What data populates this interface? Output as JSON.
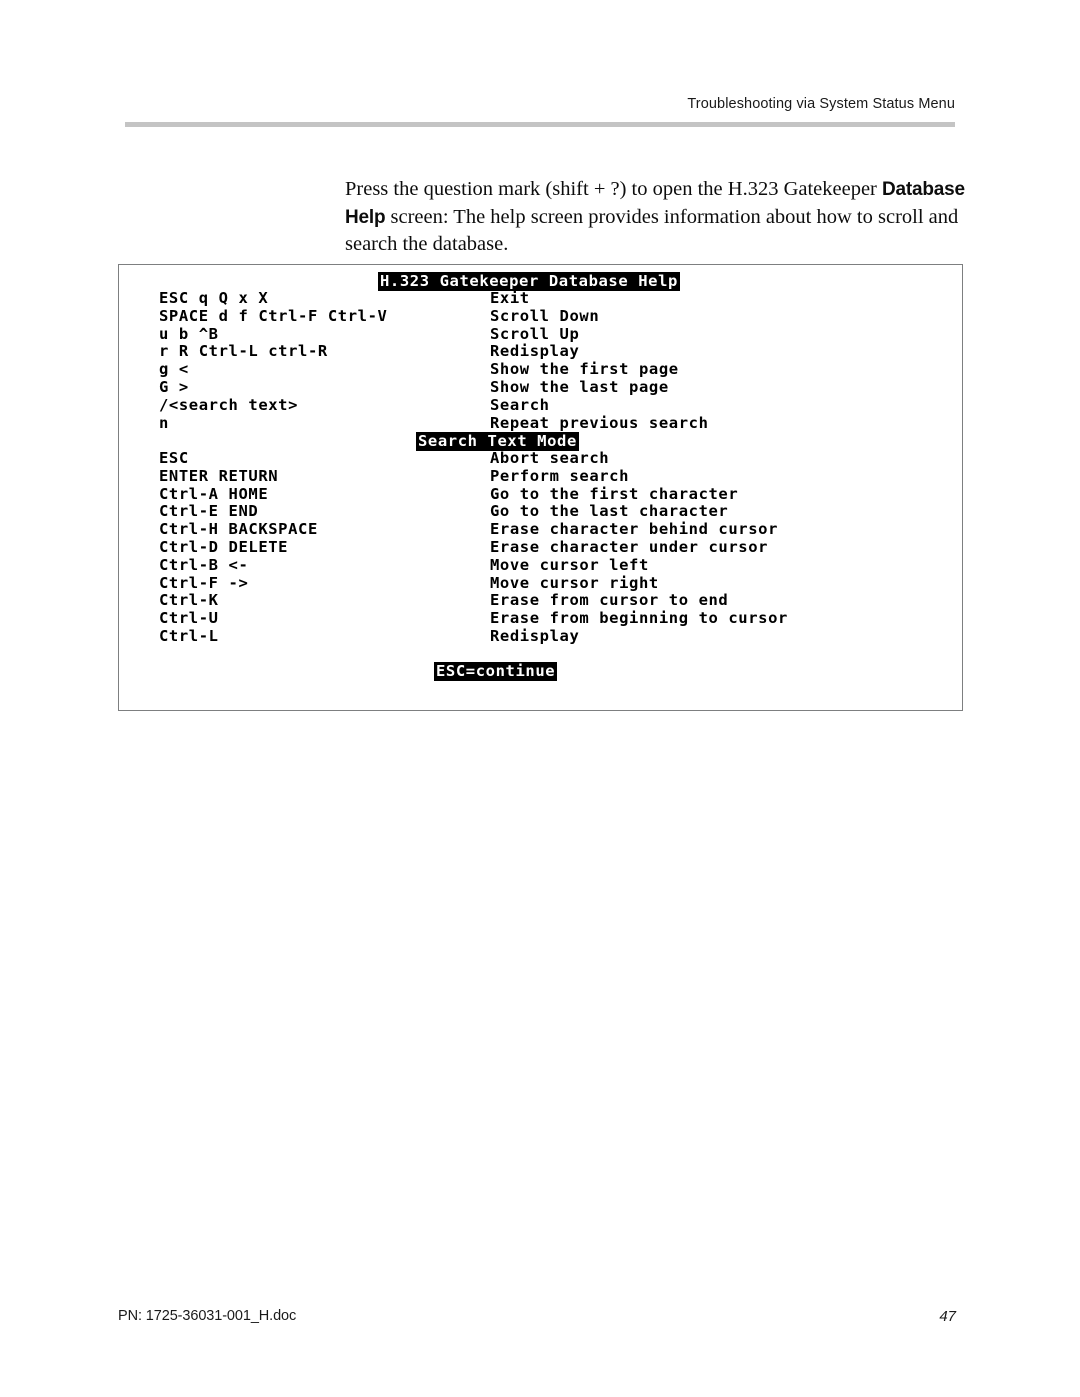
{
  "header": {
    "running_title": "Troubleshooting via System Status Menu",
    "rule_color": "#c4c4c4"
  },
  "body": {
    "paragraph_part1": "Press the question mark (shift + ?) to open the H.323 Gatekeeper ",
    "paragraph_bold": "Database Help",
    "paragraph_part2": " screen: The help screen provides information about how to scroll and search the database."
  },
  "terminal": {
    "title_banner": "H.323 Gatekeeper Database Help",
    "section_banner": "Search Text Mode",
    "footer_banner": "ESC=continue",
    "border_color": "#7d7f80",
    "navigation_rows": [
      {
        "key": "ESC q Q x X",
        "desc": "Exit"
      },
      {
        "key": "SPACE d f Ctrl-F Ctrl-V",
        "desc": "Scroll Down"
      },
      {
        "key": "u b ^B",
        "desc": "Scroll Up"
      },
      {
        "key": "r R Ctrl-L ctrl-R",
        "desc": "Redisplay"
      },
      {
        "key": "g <",
        "desc": "Show the first page"
      },
      {
        "key": "G >",
        "desc": "Show the last page"
      },
      {
        "key": "/<search text>",
        "desc": "Search"
      },
      {
        "key": "n",
        "desc": "Repeat previous search"
      }
    ],
    "search_rows": [
      {
        "key": "ESC",
        "desc": "Abort search"
      },
      {
        "key": "ENTER RETURN",
        "desc": "Perform search"
      },
      {
        "key": "Ctrl-A HOME",
        "desc": "Go to the first character"
      },
      {
        "key": "Ctrl-E END",
        "desc": "Go to the last character"
      },
      {
        "key": "Ctrl-H BACKSPACE",
        "desc": "Erase character behind cursor"
      },
      {
        "key": "Ctrl-D DELETE",
        "desc": "Erase character under cursor"
      },
      {
        "key": "Ctrl-B <-",
        "desc": "Move cursor left"
      },
      {
        "key": "Ctrl-F ->",
        "desc": "Move cursor right"
      },
      {
        "key": "Ctrl-K",
        "desc": "Erase from cursor to end"
      },
      {
        "key": "Ctrl-U",
        "desc": "Erase from beginning to cursor"
      },
      {
        "key": "Ctrl-L",
        "desc": "Redisplay"
      }
    ]
  },
  "footer": {
    "part_number": "PN: 1725-36031-001_H.doc",
    "page_number": "47"
  }
}
